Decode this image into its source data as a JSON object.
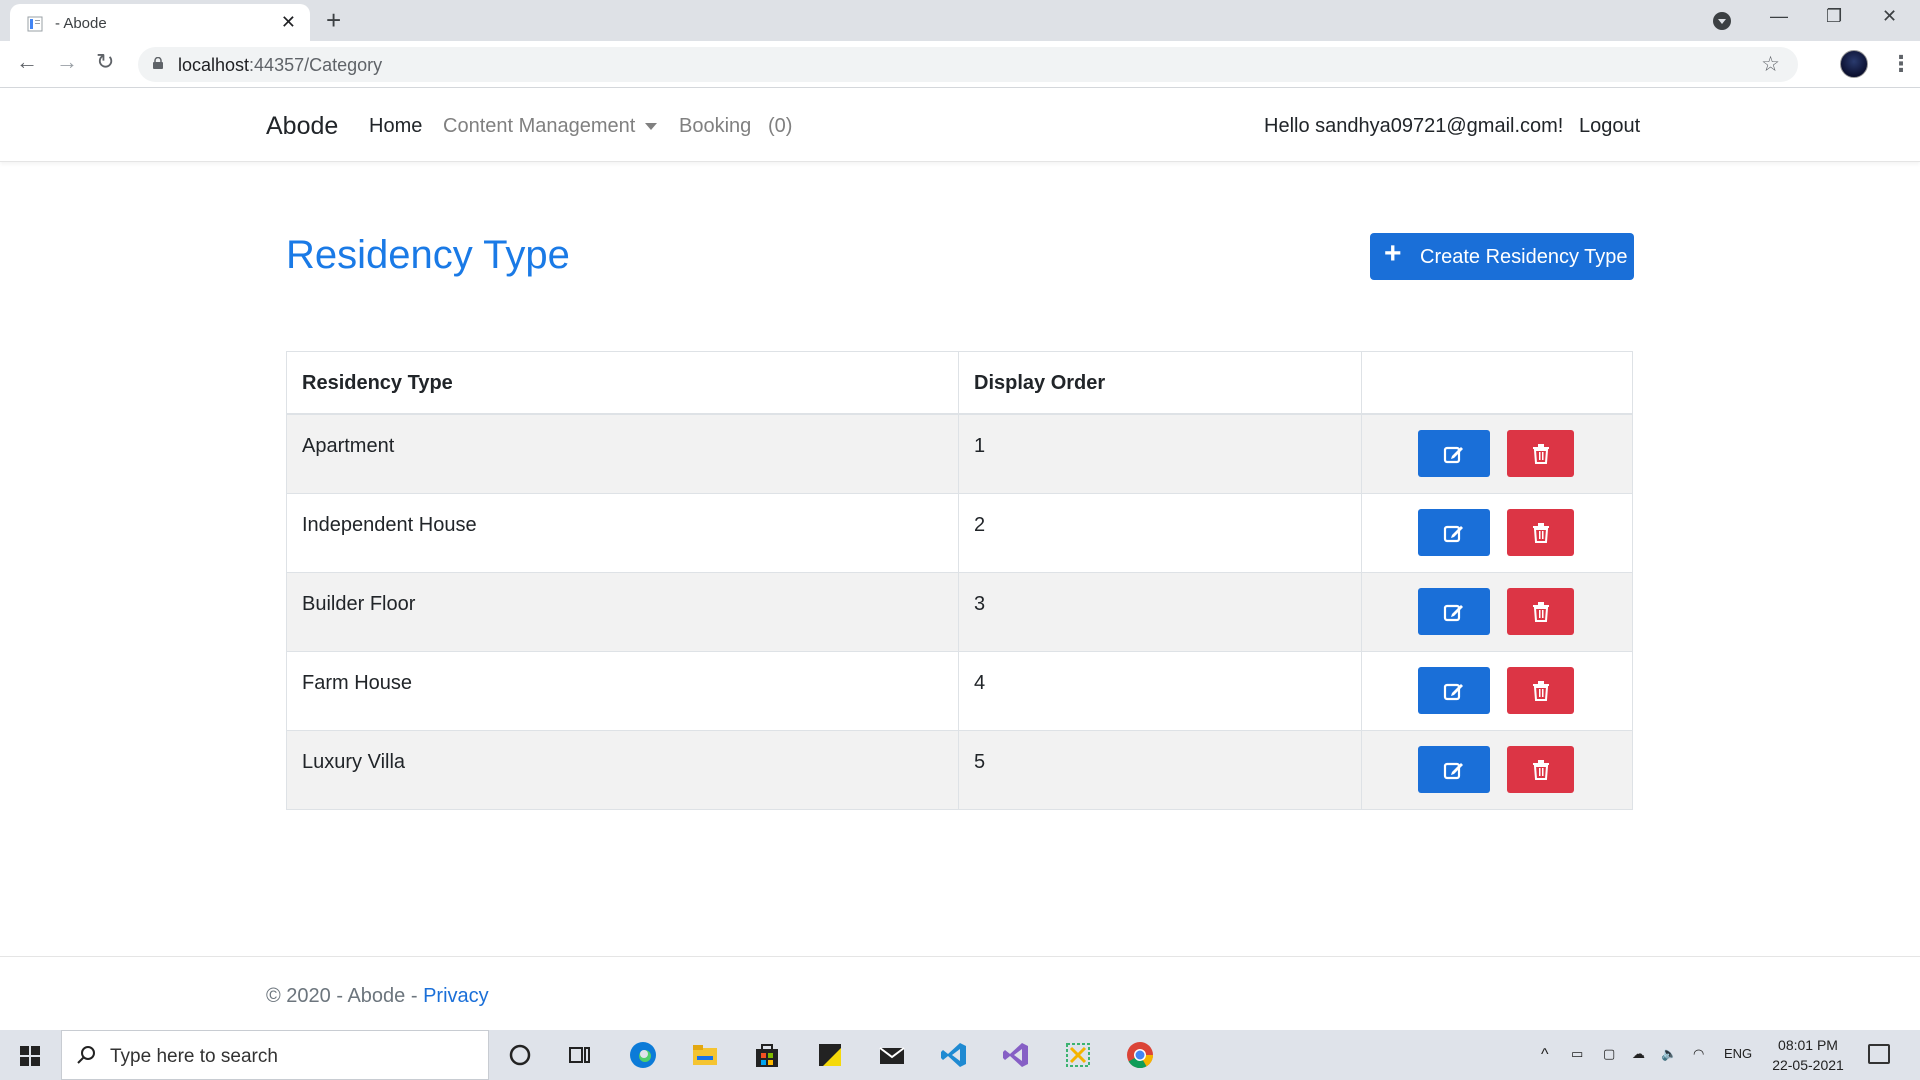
{
  "browser": {
    "tab_title": "- Abode",
    "tab_close": "✕",
    "new_tab": "+",
    "url_host": "localhost",
    "url_path": ":44357/Category",
    "controls": {
      "minimize": "—",
      "maximize": "❐",
      "close": "✕"
    }
  },
  "navbar": {
    "brand": "Abode",
    "links": {
      "home": "Home",
      "content_management": "Content Management",
      "booking": "Booking",
      "booking_count": "(0)"
    },
    "greeting": "Hello sandhya09721@gmail.com!",
    "logout": "Logout"
  },
  "main": {
    "title": "Residency Type",
    "create_button": "Create Residency Type",
    "table": {
      "headers": [
        "Residency Type",
        "Display Order",
        ""
      ],
      "rows": [
        {
          "name": "Apartment",
          "order": "1"
        },
        {
          "name": "Independent House",
          "order": "2"
        },
        {
          "name": "Builder Floor",
          "order": "3"
        },
        {
          "name": "Farm House",
          "order": "4"
        },
        {
          "name": "Luxury Villa",
          "order": "5"
        }
      ]
    }
  },
  "footer": {
    "text": "© 2020 - Abode - ",
    "privacy": "Privacy"
  },
  "taskbar": {
    "search_placeholder": "Type here to search",
    "lang": "ENG",
    "time": "08:01 PM",
    "date": "22-05-2021"
  },
  "colors": {
    "primary": "#1a6fd8",
    "danger": "#dc3545",
    "title": "#1a7ae6"
  }
}
